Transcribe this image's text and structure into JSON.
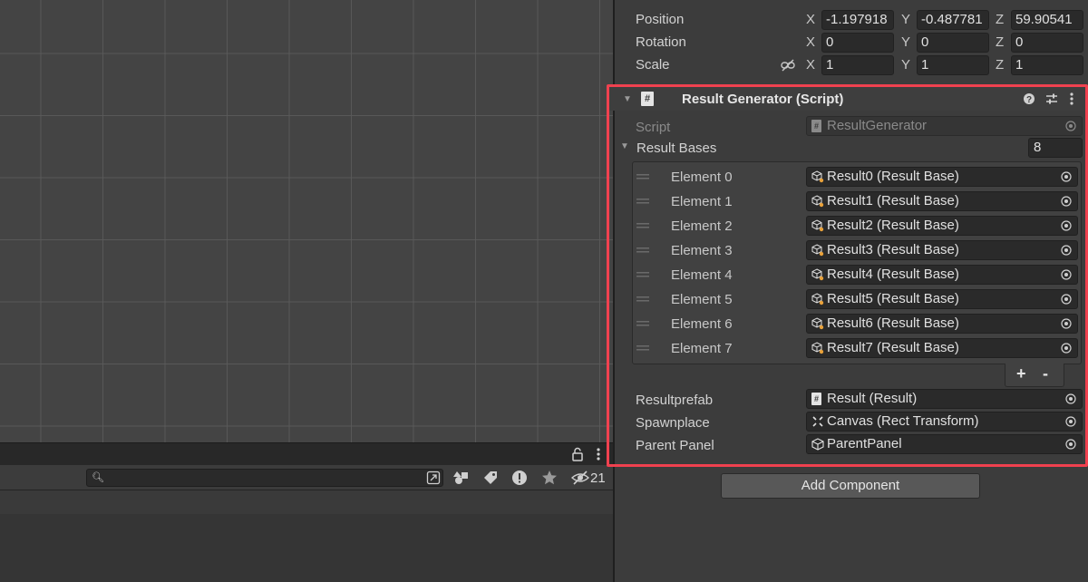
{
  "console": {
    "search_placeholder": "",
    "hidden_count": "21"
  },
  "transform": {
    "position": {
      "label": "Position",
      "x": "-1.197918",
      "y": "-0.487781",
      "z": "59.90541"
    },
    "rotation": {
      "label": "Rotation",
      "x": "0",
      "y": "0",
      "z": "0"
    },
    "scale": {
      "label": "Scale",
      "x": "1",
      "y": "1",
      "z": "1"
    },
    "axes": {
      "x": "X",
      "y": "Y",
      "z": "Z"
    }
  },
  "component": {
    "title": "Result Generator (Script)",
    "script_label": "Script",
    "script_value": "ResultGenerator",
    "list_label": "Result Bases",
    "list_size": "8",
    "elements": [
      {
        "label": "Element 0",
        "value": "Result0 (Result Base)"
      },
      {
        "label": "Element 1",
        "value": "Result1 (Result Base)"
      },
      {
        "label": "Element 2",
        "value": "Result2 (Result Base)"
      },
      {
        "label": "Element 3",
        "value": "Result3 (Result Base)"
      },
      {
        "label": "Element 4",
        "value": "Result4 (Result Base)"
      },
      {
        "label": "Element 5",
        "value": "Result5 (Result Base)"
      },
      {
        "label": "Element 6",
        "value": "Result6 (Result Base)"
      },
      {
        "label": "Element 7",
        "value": "Result7 (Result Base)"
      }
    ],
    "add_symbol": "+",
    "remove_symbol": "-",
    "resultprefab": {
      "label": "Resultprefab",
      "value": "Result (Result)"
    },
    "spawnplace": {
      "label": "Spawnplace",
      "value": "Canvas (Rect Transform)"
    },
    "parent_panel": {
      "label": "Parent Panel",
      "value": "ParentPanel"
    },
    "header_icons": [
      "help-icon",
      "preset-icon",
      "kebab-menu-icon"
    ]
  },
  "add_component_label": "Add Component",
  "colors": {
    "highlight": "#f0414f",
    "inspector_bg": "#3c3c3c",
    "field_bg": "#2a2a2a"
  }
}
